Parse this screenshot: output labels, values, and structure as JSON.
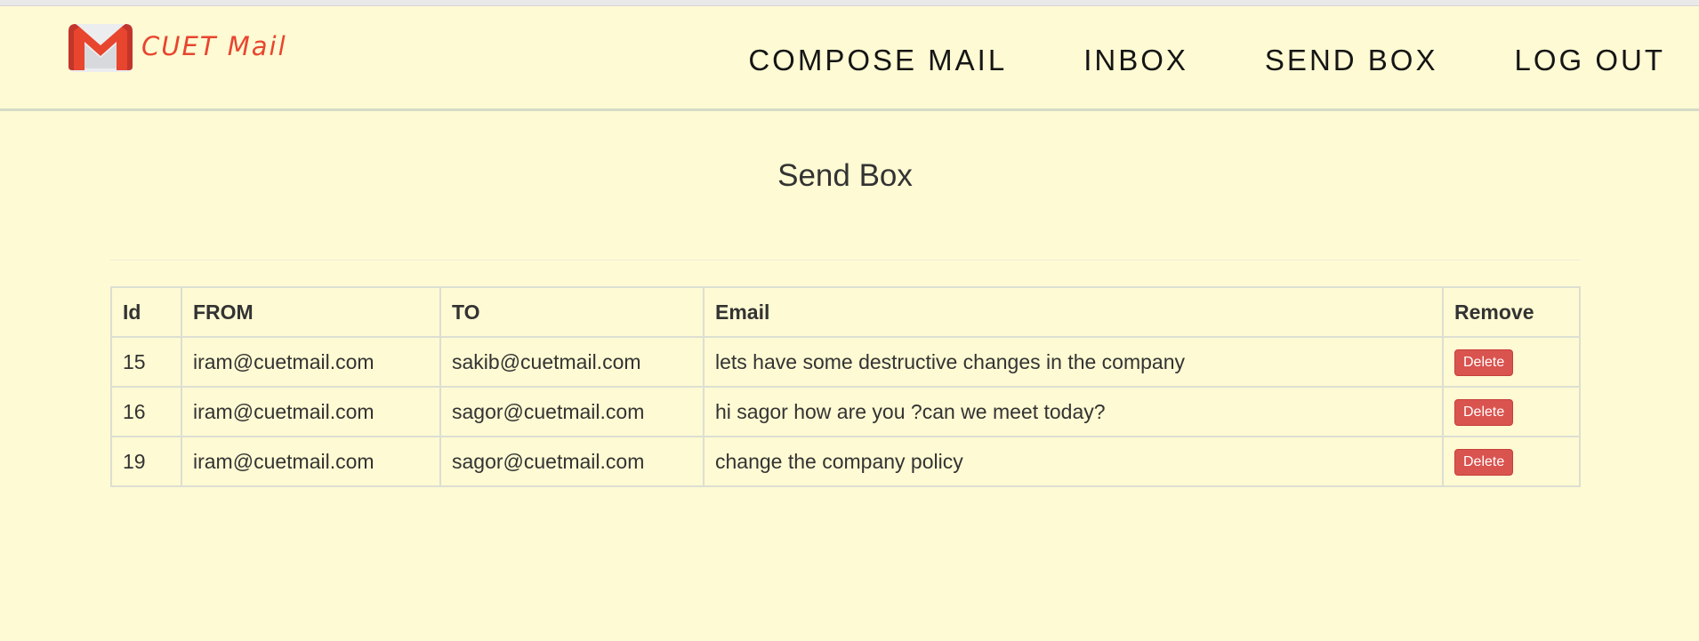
{
  "brand": {
    "name": "CUET Mail",
    "logo_icon": "gmail-m-icon",
    "color": "#e8452f"
  },
  "nav": {
    "items": [
      {
        "label": "COMPOSE MAIL"
      },
      {
        "label": "INBOX"
      },
      {
        "label": "SEND BOX"
      },
      {
        "label": "LOG OUT"
      }
    ]
  },
  "page": {
    "title": "Send Box"
  },
  "table": {
    "headers": [
      "Id",
      "FROM",
      "TO",
      "Email",
      "Remove"
    ],
    "rows": [
      {
        "id": "15",
        "from": "iram@cuetmail.com",
        "to": "sakib@cuetmail.com",
        "email": "lets have some destructive changes in the company",
        "action": "Delete"
      },
      {
        "id": "16",
        "from": "iram@cuetmail.com",
        "to": "sagor@cuetmail.com",
        "email": "hi sagor how are you ?can we meet today?",
        "action": "Delete"
      },
      {
        "id": "19",
        "from": "iram@cuetmail.com",
        "to": "sagor@cuetmail.com",
        "email": "change the company policy",
        "action": "Delete"
      }
    ]
  },
  "colors": {
    "background": "#fefad3",
    "delete_button": "#d9534f",
    "text": "#333333"
  }
}
